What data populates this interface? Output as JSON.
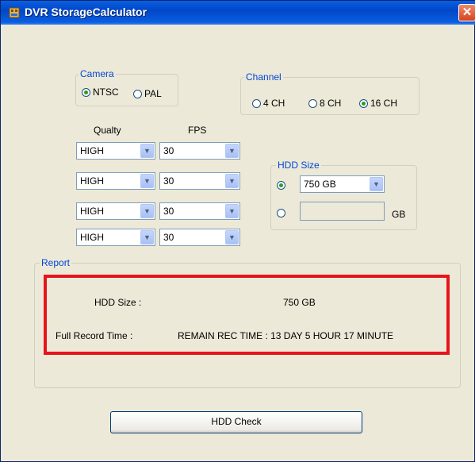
{
  "window": {
    "title": "DVR StorageCalculator",
    "close_symbol": "✕"
  },
  "camera": {
    "label": "Camera",
    "options": [
      "NTSC",
      "PAL"
    ],
    "selected": "NTSC"
  },
  "channel": {
    "label": "Channel",
    "options": [
      "4 CH",
      "8 CH",
      "16 CH"
    ],
    "selected": "16 CH"
  },
  "quality_fps": {
    "quality_header": "Qualty",
    "fps_header": "FPS",
    "rows": [
      {
        "quality": "HIGH",
        "fps": "30"
      },
      {
        "quality": "HIGH",
        "fps": "30"
      },
      {
        "quality": "HIGH",
        "fps": "30"
      },
      {
        "quality": "HIGH",
        "fps": "30"
      }
    ]
  },
  "hdd_size": {
    "label": "HDD Size",
    "selected_value": "750 GB",
    "custom_value": "",
    "unit": "GB"
  },
  "report": {
    "label": "Report",
    "hdd_size_label": "HDD Size :",
    "hdd_size_value": "750 GB",
    "full_record_label": "Full Record Time :",
    "full_record_value": "REMAIN REC TIME : 13 DAY 5 HOUR 17 MINUTE"
  },
  "actions": {
    "hdd_check": "HDD Check"
  },
  "colors": {
    "titlebar": "#0A5FE0",
    "window_bg": "#ECE9D8",
    "group_label": "#0046D5",
    "report_highlight": "#E8141C"
  }
}
